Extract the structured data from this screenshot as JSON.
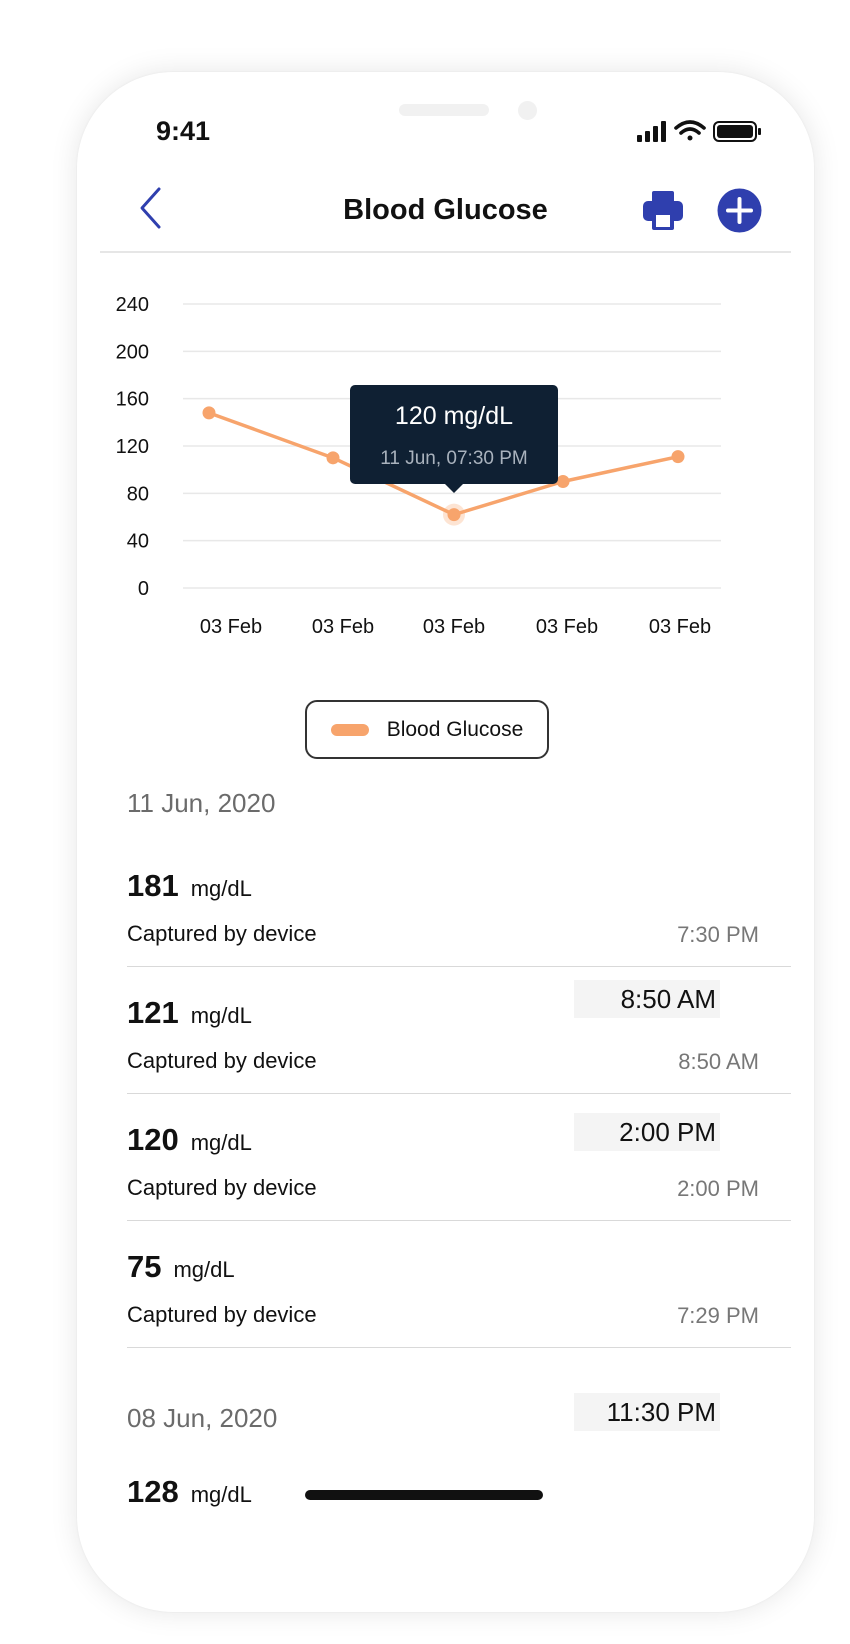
{
  "status_bar": {
    "time": "9:41"
  },
  "nav": {
    "title": "Blood Glucose"
  },
  "colors": {
    "accent": "#2f3fae",
    "line": "#f7a46c",
    "tooltip_bg": "#0f2033"
  },
  "icons": {
    "back": "chevron-left-icon",
    "print": "printer-icon",
    "add": "plus-circle-icon"
  },
  "chart_data": {
    "type": "line",
    "y_ticks": [
      "240",
      "200",
      "160",
      "120",
      "80",
      "40",
      "0"
    ],
    "ylim": [
      0,
      240
    ],
    "categories": [
      "03 Feb",
      "03 Feb",
      "03 Feb",
      "03 Feb",
      "03 Feb"
    ],
    "series": [
      {
        "name": "Blood Glucose",
        "values": [
          148,
          110,
          62,
          90,
          111
        ]
      }
    ],
    "grid": true,
    "legend": "bottom-center",
    "tooltip": {
      "value": "120 mg/dL",
      "date": "11 Jun,",
      "time": "07:30 PM",
      "point_index": 2
    }
  },
  "readings": {
    "group1": {
      "date": "11 Jun, 2020",
      "items": [
        {
          "value": "181",
          "unit": "mg/dL",
          "source": "Captured by device",
          "time": "7:30 PM"
        },
        {
          "value": "121",
          "unit": "mg/dL",
          "source": "Captured by device",
          "time": "8:50 AM"
        },
        {
          "value": "120",
          "unit": "mg/dL",
          "source": "Captured by device",
          "time": "2:00 PM"
        },
        {
          "value": "75",
          "unit": "mg/dL",
          "source": "Captured by device",
          "time": "7:29 PM"
        }
      ]
    },
    "group2": {
      "date": "08 Jun, 2020",
      "items": [
        {
          "value": "128",
          "unit": "mg/dL"
        }
      ]
    }
  },
  "time_chips": [
    "8:50 AM",
    "2:00 PM",
    "11:30 PM"
  ]
}
